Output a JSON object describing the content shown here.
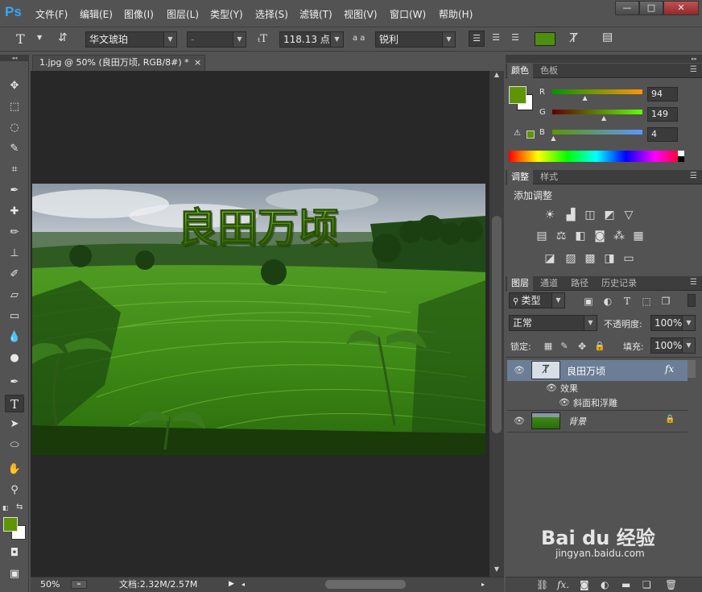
{
  "app": {
    "logo": "Ps"
  },
  "menu": [
    "文件(F)",
    "编辑(E)",
    "图像(I)",
    "图层(L)",
    "类型(Y)",
    "选择(S)",
    "滤镜(T)",
    "视图(V)",
    "窗口(W)",
    "帮助(H)"
  ],
  "window_controls": {
    "minimize": "—",
    "maximize": "□",
    "close": "✕"
  },
  "options": {
    "tool_glyph": "T",
    "font_family": "华文琥珀",
    "font_style": "-",
    "font_size": "118.13 点",
    "aa_label": "a a",
    "antialias": "锐利",
    "text_color": "#4e8f0e"
  },
  "document": {
    "tab_title": "1.jpg @ 50% (良田万顷, RGB/8#) *",
    "close": "×",
    "overlay_text": "良田万顷"
  },
  "status": {
    "zoom": "50%",
    "doc_size": "文档:2.32M/2.57M"
  },
  "color_panel": {
    "tabs": [
      "颜色",
      "色板"
    ],
    "r_label": "R",
    "g_label": "G",
    "b_label": "B",
    "r": "94",
    "g": "149",
    "b": "4",
    "fg": "#5e9504",
    "bg": "#ffffff",
    "r_pos": 0.37,
    "g_pos": 0.58,
    "b_pos": 0.02
  },
  "adjust_panel": {
    "tabs": [
      "调整",
      "样式"
    ],
    "title": "添加调整"
  },
  "layers_panel": {
    "tabs": [
      "图层",
      "通道",
      "路径",
      "历史记录"
    ],
    "filter": "类型",
    "blend_mode": "正常",
    "opacity_label": "不透明度:",
    "opacity": "100%",
    "lock_label": "锁定:",
    "fill_label": "填充:",
    "fill": "100%",
    "layers": [
      {
        "name": "良田万顷",
        "fx": "fx",
        "effects_label": "效果",
        "effect": "斜面和浮雕"
      },
      {
        "name": "背景"
      }
    ]
  },
  "watermark": {
    "brand": "Bai du 经验",
    "url": "jingyan.baidu.com"
  }
}
